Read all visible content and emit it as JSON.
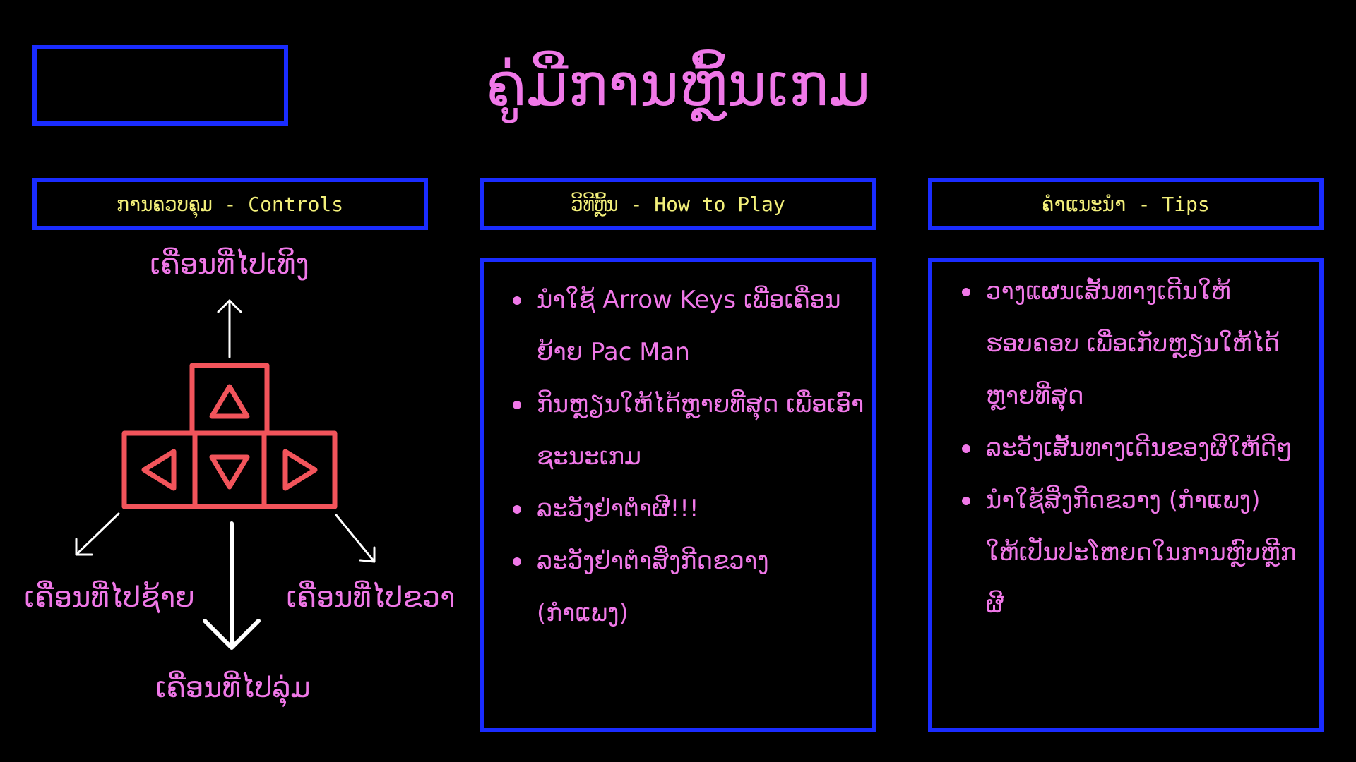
{
  "title": "ຄູ່ມືການຫຼິ້ນເກມ",
  "colors": {
    "background": "#000000",
    "frame": "#1a2cff",
    "title": "#f078e8",
    "header_text": "#f2ef7a",
    "keys": "#f2545b",
    "arrows": "#ffffff"
  },
  "sections": {
    "controls": {
      "header": "ການຄວບຄຸມ - Controls",
      "up": "ເຄື່ອນທີ່ໄປເທິງ",
      "left": "ເຄື່ອນທີ່ໄປຊ້າຍ",
      "right": "ເຄື່ອນທີ່ໄປຂວາ",
      "down": "ເຄື່ອນທີ່ໄປລຸ່ມ",
      "icons": [
        "arrow-key-up-icon",
        "arrow-key-left-icon",
        "arrow-key-down-icon",
        "arrow-key-right-icon"
      ]
    },
    "how_to_play": {
      "header": "ວິທີຫຼິ້ນ - How to Play",
      "items": [
        "ນຳໃຊ້ Arrow Keys ເພື່ອເຄື່ອນຍ້າຍ Pac Man",
        "ກິນຫຼຽນໃຫ້ໄດ້ຫຼາຍທີ່ສຸດ ເພື່ອເອົາຊະນະເກມ",
        "ລະວັງຢ່າຕຳຜີ!!!",
        "ລະວັງຢ່າຕຳສິ່ງກີດຂວາງ (ກຳແພງ)"
      ]
    },
    "tips": {
      "header": "ຄຳແນະນຳ - Tips",
      "items": [
        "ວາງແຜນເສັ້ນທາງເດີນໃຫ້ຮອບຄອບ ເພື່ອເກັບຫຼຽນໃຫ້ໄດ້ຫຼາຍທີ່ສຸດ",
        "ລະວັງເສັ້ນທາງເດີນຂອງຜີໃຫ້ດີໆ",
        "ນຳໃຊ້ສິ່ງກີດຂວາງ (ກຳແພງ) ໃຫ້ເປັນປະໂຫຍດໃນການຫຼົບຫຼີກຜີ"
      ]
    }
  }
}
